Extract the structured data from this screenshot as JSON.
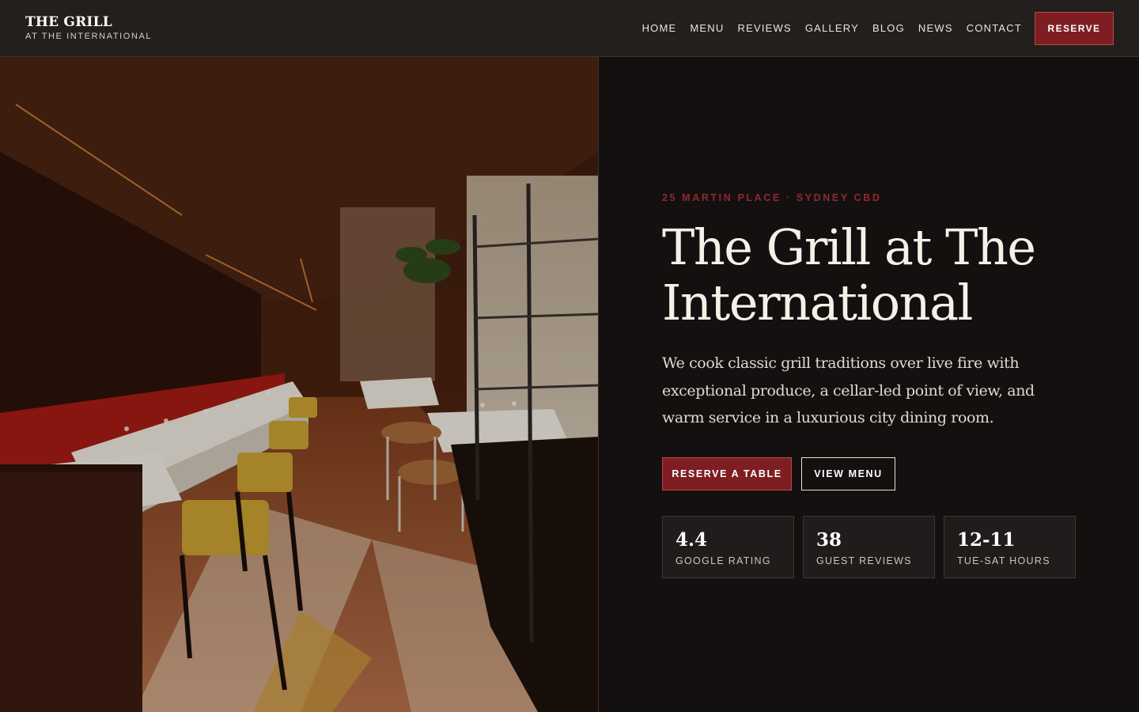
{
  "header": {
    "brand_name": "THE GRILL",
    "brand_sub": "AT THE INTERNATIONAL",
    "nav": [
      "HOME",
      "MENU",
      "REVIEWS",
      "GALLERY",
      "BLOG",
      "NEWS",
      "CONTACT"
    ],
    "reserve_label": "RESERVE"
  },
  "hero": {
    "eyebrow": "25 MARTIN PLACE · SYDNEY CBD",
    "title": "The Grill at The International",
    "description": "We cook classic grill traditions over live fire with exceptional produce, a cellar-led point of view, and warm service in a luxurious city dining room.",
    "primary_cta": "RESERVE A TABLE",
    "secondary_cta": "VIEW MENU",
    "stats": [
      {
        "value": "4.4",
        "label": "GOOGLE RATING"
      },
      {
        "value": "38",
        "label": "GUEST REVIEWS"
      },
      {
        "value": "12-11",
        "label": "TUE-SAT HOURS"
      }
    ]
  },
  "colors": {
    "accent": "#7e1e22",
    "eyebrow": "#8f2a2d",
    "background": "#141010",
    "header_bg": "#231f1d"
  }
}
